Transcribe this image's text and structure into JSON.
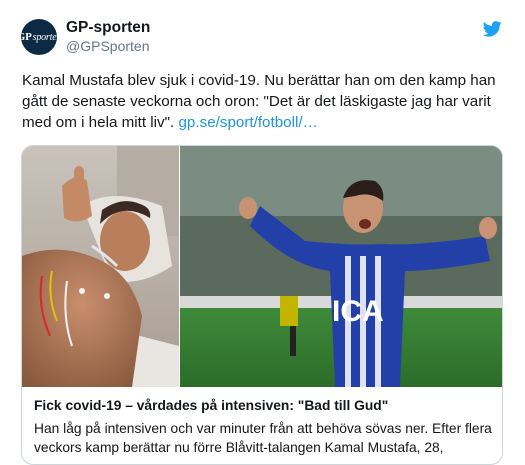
{
  "author": {
    "name": "GP-sporten",
    "handle": "@GPSporten",
    "avatar_text_bold": "GP",
    "avatar_text_italic": "sporten"
  },
  "tweet": {
    "text": "Kamal Mustafa blev sjuk i covid-19. Nu berättar han om den kamp han gått de senaste veckorna och oron: \"Det är det läskigaste jag har varit med om i hela mitt liv\".",
    "link_text": "gp.se/sport/fotboll/…"
  },
  "card": {
    "title": "Fick covid-19 – vårdades på intensiven: \"Bad till Gud\"",
    "description": "Han låg på intensiven och var minuter från att behöva sövas ner. Efter flera veckors kamp berättar nu förre Blåvitt-talangen Kamal Mustafa, 28,",
    "right_image_shirt_text": "ICA"
  },
  "icons": {
    "brand": "twitter-bird-icon"
  },
  "colors": {
    "link": "#1b95e0",
    "twitter_blue": "#1da1f2",
    "border": "#ccd6dd",
    "handle": "#657786"
  }
}
